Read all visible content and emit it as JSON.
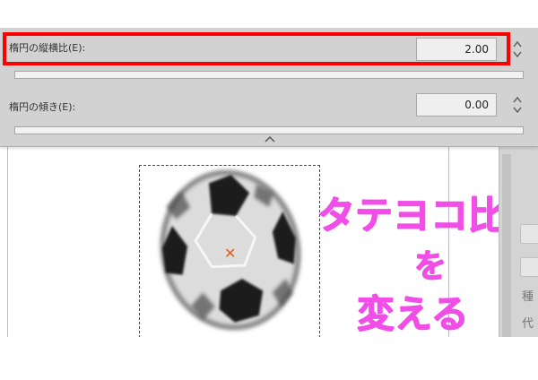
{
  "popup": {
    "aspect_ratio": {
      "label": "楕円の縦横比(E):",
      "value": "2.00"
    },
    "tilt": {
      "label": "楕円の傾き(E):",
      "value": "0.00"
    }
  },
  "annotation": {
    "lines": [
      "タテヨコ比",
      "を",
      "変える"
    ],
    "color": "#f04ee6",
    "highlight_color": "#ff0000"
  },
  "right_panel": {
    "glyphs": [
      "種",
      "代"
    ]
  },
  "colors": {
    "popup_bg": "#d2d2d2",
    "center_mark": "#ee5a12"
  }
}
